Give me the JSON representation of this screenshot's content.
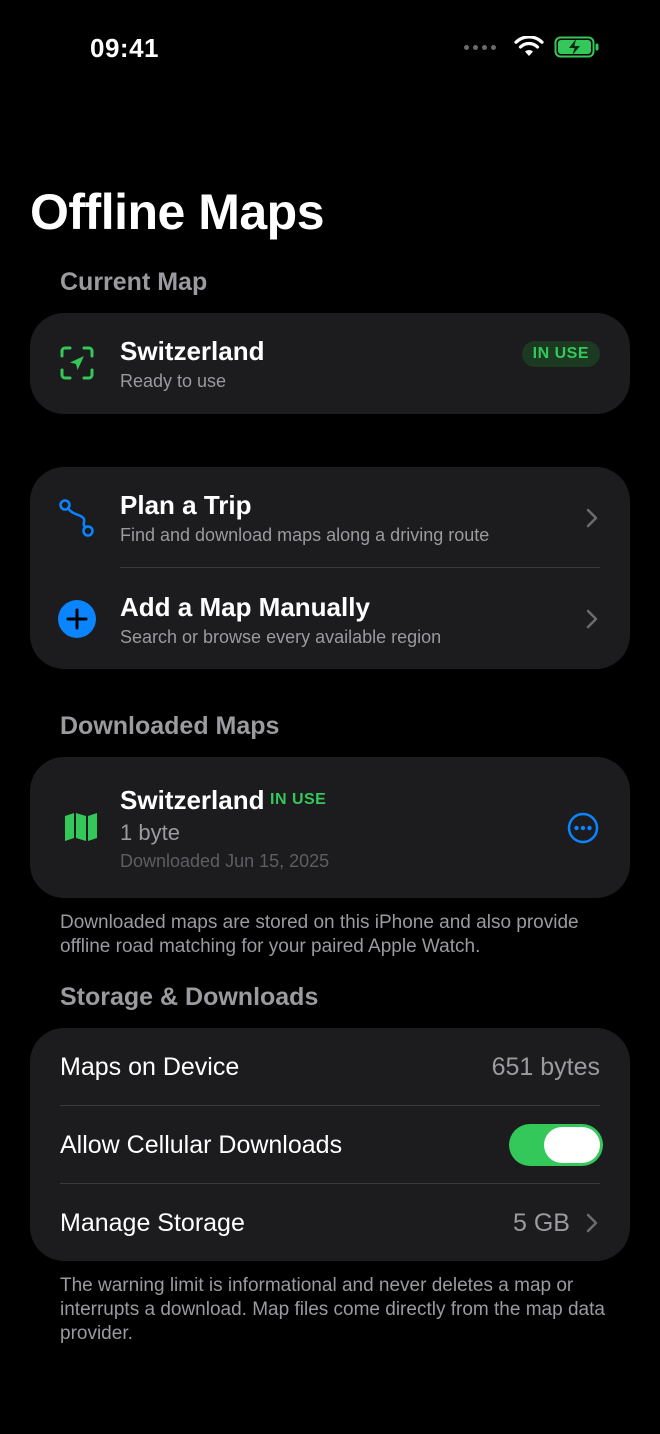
{
  "status_bar": {
    "time": "09:41"
  },
  "page_title": "Offline Maps",
  "current_map": {
    "header": "Current Map",
    "name": "Switzerland",
    "status": "Ready to use",
    "badge": "IN USE"
  },
  "actions": [
    {
      "title": "Plan a Trip",
      "subtitle": "Find and download maps along a driving route",
      "icon": "route-icon"
    },
    {
      "title": "Add a Map Manually",
      "subtitle": "Search or browse every available region",
      "icon": "plus-circle-icon"
    }
  ],
  "downloaded_maps": {
    "header": "Downloaded Maps",
    "items": [
      {
        "name": "Switzerland",
        "badge": "IN USE",
        "size": "1 byte",
        "date": "Downloaded Jun 15, 2025"
      }
    ],
    "footnote": "Downloaded maps are stored on this iPhone and also provide offline road matching for your paired Apple Watch."
  },
  "storage": {
    "header": "Storage & Downloads",
    "maps_on_device_label": "Maps on Device",
    "maps_on_device_value": "651 bytes",
    "cellular_label": "Allow Cellular Downloads",
    "cellular_enabled": true,
    "manage_label": "Manage Storage",
    "manage_value": "5 GB",
    "footnote": "The warning limit is informational and never deletes a map or interrupts a download. Map files come directly from the map data provider."
  },
  "colors": {
    "accent_green": "#34c759",
    "accent_blue": "#0a84ff",
    "card_bg": "#1c1c1e"
  }
}
